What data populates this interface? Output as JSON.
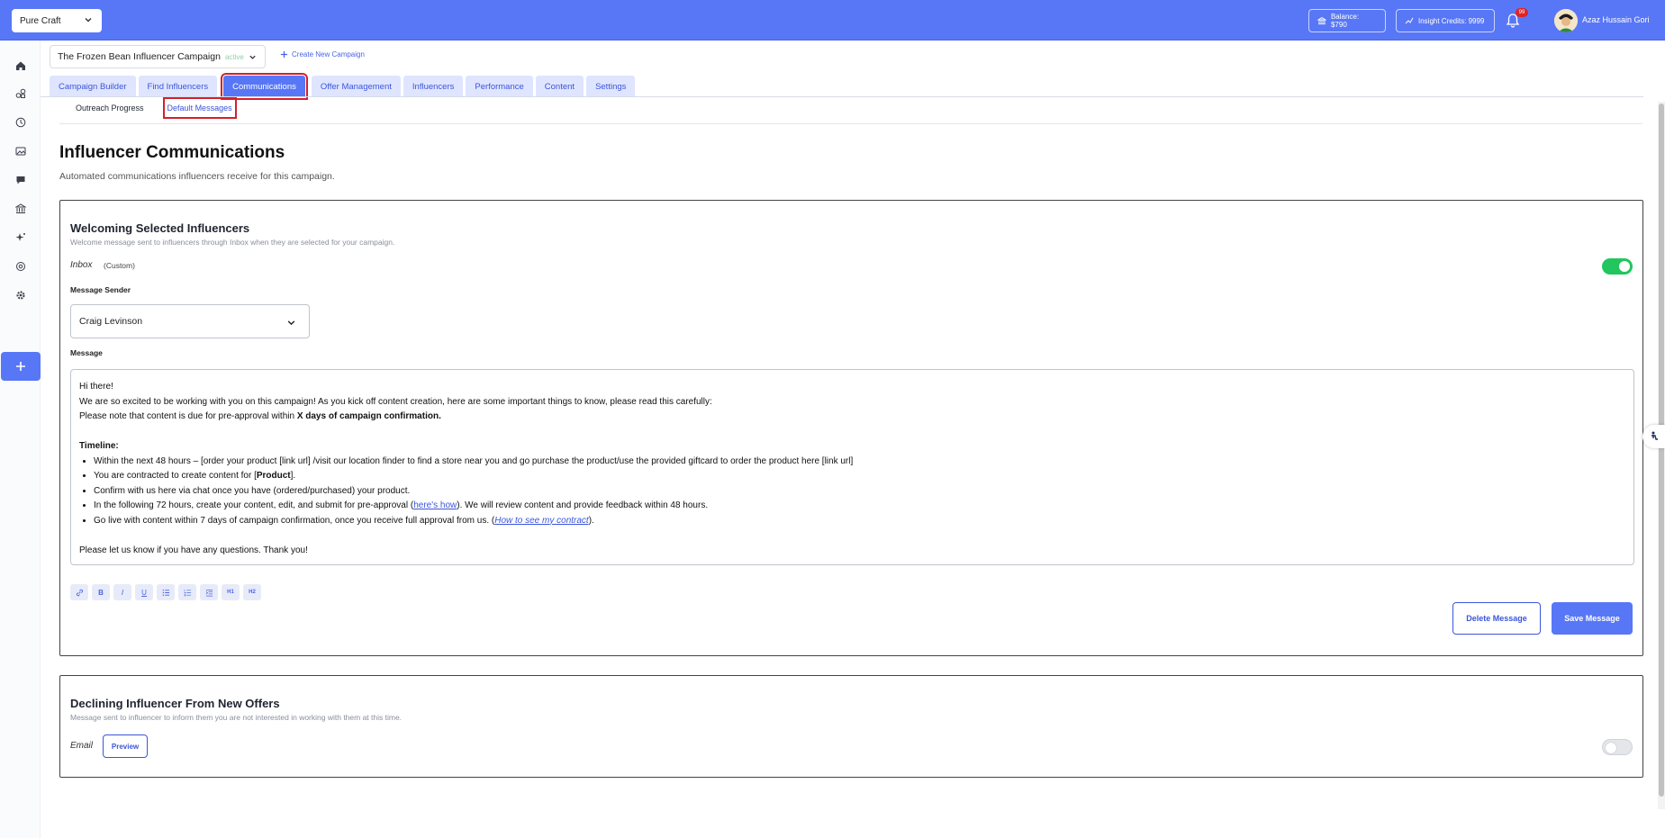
{
  "topbar": {
    "brand": "Pure Craft",
    "balance": "Balance: $790",
    "insight_credits": "Insight Credits: 9999",
    "notifications_count": "99",
    "user_name": "Azaz Hussain Gori"
  },
  "sidebar": {
    "items": [
      "home-icon",
      "influencers-icon",
      "history-icon",
      "media-icon",
      "chat-icon",
      "bank-icon",
      "ai-sparkle-icon",
      "settings-icon",
      "gear-icon"
    ]
  },
  "campaign": {
    "name": "The Frozen Bean Influencer Campaign",
    "status": "active",
    "create_new": "Create New Campaign"
  },
  "tabs": [
    {
      "label": "Campaign Builder",
      "active": false
    },
    {
      "label": "Find Influencers",
      "active": false
    },
    {
      "label": "Communications",
      "active": true
    },
    {
      "label": "Offer Management",
      "active": false
    },
    {
      "label": "Influencers",
      "active": false
    },
    {
      "label": "Performance",
      "active": false
    },
    {
      "label": "Content",
      "active": false
    },
    {
      "label": "Settings",
      "active": false
    }
  ],
  "subtabs": [
    {
      "label": "Outreach Progress",
      "active": false
    },
    {
      "label": "Default Messages",
      "active": true
    }
  ],
  "page": {
    "title": "Influencer Communications",
    "subtitle": "Automated communications influencers receive for this campaign."
  },
  "welcome_card": {
    "title": "Welcoming Selected Influencers",
    "description": "Welcome message sent to influencers through Inbox when they are selected for your campaign.",
    "channel": "Inbox",
    "custom_tag": "(Custom)",
    "enabled": true,
    "sender_label": "Message Sender",
    "sender_value": "Craig Levinson",
    "message_label": "Message",
    "message": {
      "greeting": "Hi there!",
      "intro": "We are so excited to be working with you on this campaign! As you kick off content creation, here are some important things to know, please read this carefully:",
      "note_prefix": "Please note that content is due for pre-approval within ",
      "note_bold": "X days of campaign confirmation.",
      "timeline_heading": "Timeline:",
      "bullet1": "Within the next 48 hours – [order your product [link url] /visit our location finder to find a store near you and go purchase the product/use the provided giftcard to order the product here [link url]",
      "bullet2_prefix": "You are contracted to create content for [",
      "bullet2_bold": "Product",
      "bullet2_suffix": "].",
      "bullet3": "Confirm with us here via chat once you have (ordered/purchased) your product.",
      "bullet4_prefix": "In the following 72 hours, create your content, edit, and submit for pre-approval (",
      "bullet4_link": "here's how",
      "bullet4_suffix": "). We will review content and provide feedback within 48 hours.",
      "bullet5_prefix": "Go live with content within 7 days of campaign confirmation, once you receive full approval from us. (",
      "bullet5_link": "How to see my contract",
      "bullet5_suffix": ").",
      "closing": "Please let us know if you have any questions. Thank you!"
    },
    "toolbar": [
      "link-icon",
      "bold-icon",
      "italic-icon",
      "underline-icon",
      "bulleted-list-icon",
      "numbered-list-icon",
      "indent-icon",
      "heading-1-icon",
      "heading-2-icon"
    ],
    "toolbar_labels": {
      "bold": "B",
      "italic": "I",
      "underline": "U",
      "h1": "H1",
      "h2": "H2"
    },
    "delete_button": "Delete Message",
    "save_button": "Save Message"
  },
  "decline_card": {
    "title": "Declining Influencer From New Offers",
    "description": "Message sent to influencer to inform them you are not interested in working with them at this time.",
    "channel": "Email",
    "preview_button": "Preview",
    "enabled": false
  },
  "colors": {
    "primary": "#5877f6",
    "tab_inactive_bg": "#dfe5ff",
    "toggle_on": "#22c55e",
    "highlight_outline": "#d61f2c"
  }
}
